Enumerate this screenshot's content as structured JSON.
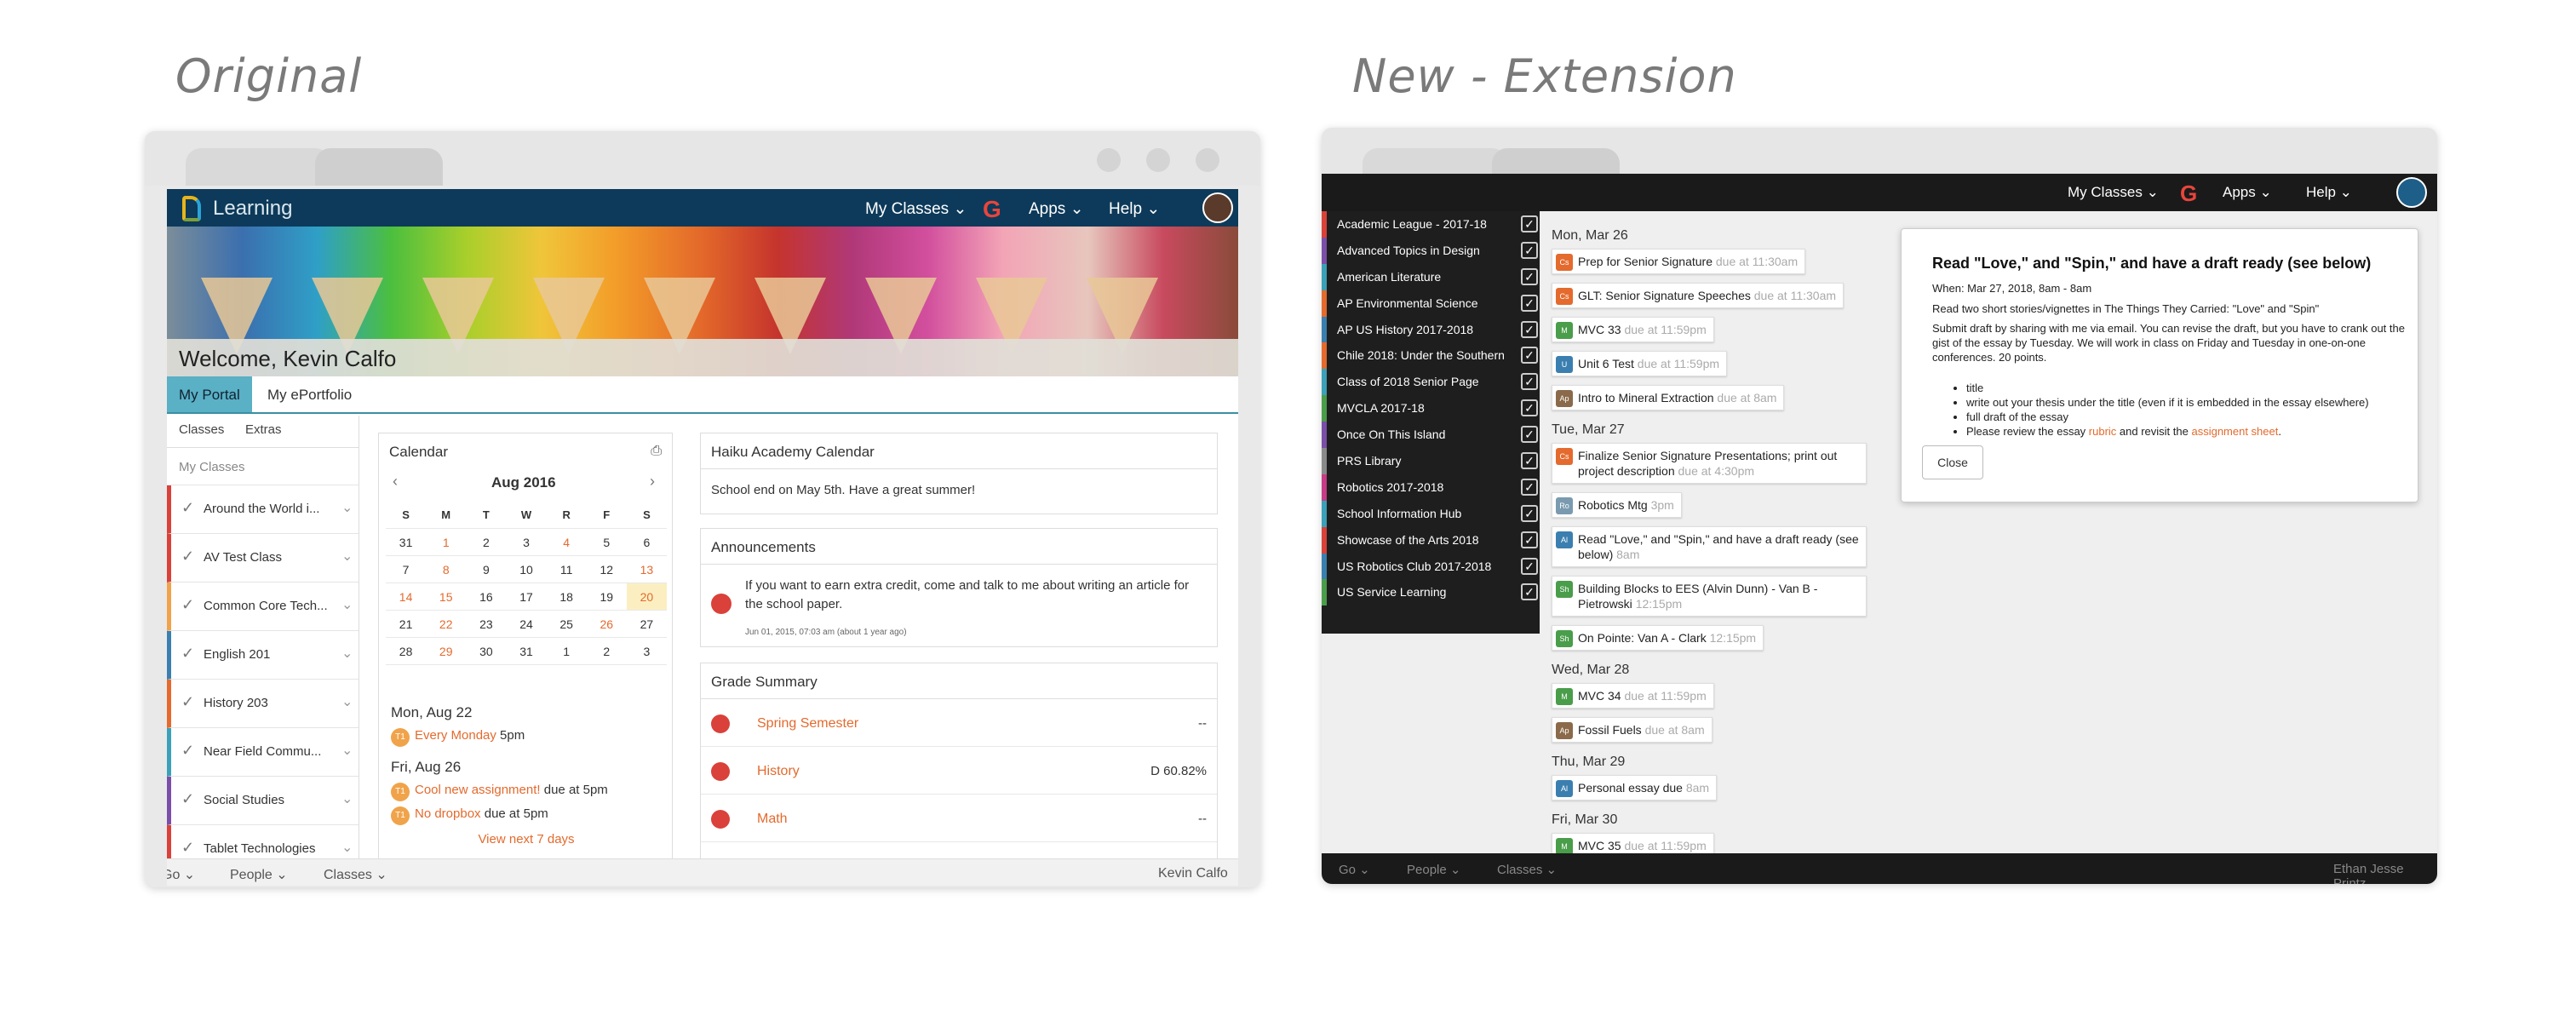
{
  "headings": {
    "left": "Original",
    "right": "New - Extension"
  },
  "original": {
    "brand": "Learning",
    "nav": {
      "my_classes": "My Classes ⌄",
      "apps": "Apps ⌄",
      "help": "Help ⌄",
      "google": "G"
    },
    "welcome": "Welcome, Kevin Calfo",
    "tabs": [
      "My Portal",
      "My ePortfolio"
    ],
    "sidebar": {
      "tabs": [
        "Classes",
        "Extras"
      ],
      "heading": "My Classes",
      "classes": [
        {
          "label": "Around the World i...",
          "color": "#d9413a"
        },
        {
          "label": "AV Test Class",
          "color": "#d9413a"
        },
        {
          "label": "Common Core Tech...",
          "color": "#f0a34a"
        },
        {
          "label": "English 201",
          "color": "#3b7fb0"
        },
        {
          "label": "History 203",
          "color": "#e46a2d"
        },
        {
          "label": "Near Field Commu...",
          "color": "#3aa1b8"
        },
        {
          "label": "Social Studies",
          "color": "#7b4fa8"
        },
        {
          "label": "Tablet Technologies",
          "color": "#d9413a"
        }
      ]
    },
    "calendar": {
      "title": "Calendar",
      "print_icon": "printer-icon",
      "month": "Aug 2016",
      "prev": "‹",
      "next": "›",
      "weekdays": [
        "S",
        "M",
        "T",
        "W",
        "R",
        "F",
        "S"
      ],
      "weeks": [
        [
          "31",
          "1",
          "2",
          "3",
          "4",
          "5",
          "6"
        ],
        [
          "7",
          "8",
          "9",
          "10",
          "11",
          "12",
          "13"
        ],
        [
          "14",
          "15",
          "16",
          "17",
          "18",
          "19",
          "20"
        ],
        [
          "21",
          "22",
          "23",
          "24",
          "25",
          "26",
          "27"
        ],
        [
          "28",
          "29",
          "30",
          "31",
          "1",
          "2",
          "3"
        ]
      ],
      "event_days": [
        {
          "date": "Mon, Aug 22",
          "events": [
            {
              "badge": "T1",
              "link": "Every Monday",
              "suffix": " 5pm"
            }
          ]
        },
        {
          "date": "Fri, Aug 26",
          "events": [
            {
              "badge": "T1",
              "link": "Cool new assignment!",
              "suffix": " due at 5pm"
            },
            {
              "badge": "T1",
              "link": "No dropbox",
              "suffix": " due at 5pm"
            }
          ]
        }
      ],
      "view_next": "View next 7 days"
    },
    "haiku": {
      "title": "Haiku Academy Calendar",
      "body": "School end on May 5th. Have a great summer!"
    },
    "announcements": {
      "title": "Announcements",
      "text": "If you want to earn extra credit, come and talk to me about writing an article for the school paper.",
      "meta": "Jun 01, 2015, 07:03 am (about 1 year ago)"
    },
    "grades": {
      "title": "Grade Summary",
      "rows": [
        {
          "name": "Spring Semester",
          "value": "--"
        },
        {
          "name": "History",
          "value": "D 60.82%"
        },
        {
          "name": "Math",
          "value": "--"
        }
      ]
    },
    "bottom": {
      "go": "Go ⌄",
      "people": "People ⌄",
      "classes": "Classes ⌄",
      "user": "Kevin Calfo"
    }
  },
  "extension": {
    "nav": {
      "my_classes": "My Classes ⌄",
      "apps": "Apps ⌄",
      "help": "Help ⌄",
      "google": "G"
    },
    "sidebar": [
      {
        "label": "Academic League - 2017-18",
        "color": "#d9413a"
      },
      {
        "label": "Advanced Topics in Design",
        "color": "#7b4fa8"
      },
      {
        "label": "American Literature",
        "color": "#3aa1b8"
      },
      {
        "label": "AP Environmental Science",
        "color": "#e46a2d"
      },
      {
        "label": "AP US History 2017-2018",
        "color": "#3b7fb0"
      },
      {
        "label": "Chile 2018: Under the Southern",
        "color": "#e46a2d"
      },
      {
        "label": "Class of 2018 Senior Page",
        "color": "#3aa1b8"
      },
      {
        "label": "MVCLA 2017-18",
        "color": "#4a9d4a"
      },
      {
        "label": "Once On This Island",
        "color": "#7b4fa8"
      },
      {
        "label": "PRS Library",
        "color": "#8a8a8a"
      },
      {
        "label": "Robotics 2017-2018",
        "color": "#c63c86"
      },
      {
        "label": "School Information Hub",
        "color": "#3aa1b8"
      },
      {
        "label": "Showcase of the Arts 2018",
        "color": "#d9413a"
      },
      {
        "label": "US Robotics Club 2017-2018",
        "color": "#3b7fb0"
      },
      {
        "label": "US Service Learning",
        "color": "#4a9d4a"
      }
    ],
    "feed": [
      {
        "day": "Mon, Mar 26",
        "items": [
          {
            "badge": "Cs",
            "color": "#e46a2d",
            "title": "Prep for Senior Signature",
            "due": "due at 11:30am"
          },
          {
            "badge": "Cs",
            "color": "#e46a2d",
            "title": "GLT: Senior Signature Speeches",
            "due": "due at 11:30am"
          },
          {
            "badge": "M",
            "color": "#4a9d4a",
            "title": "MVC 33",
            "due": "due at 11:59pm"
          },
          {
            "badge": "U",
            "color": "#3b7fb0",
            "title": "Unit 6 Test",
            "due": "due at 11:59pm"
          },
          {
            "badge": "Ap",
            "color": "#8a6a4a",
            "title": "Intro to Mineral Extraction",
            "due": "due at 8am"
          }
        ]
      },
      {
        "day": "Tue, Mar 27",
        "items": [
          {
            "badge": "Cs",
            "color": "#e46a2d",
            "title": "Finalize Senior Signature Presentations; print out project description",
            "due": "due at 4:30pm"
          },
          {
            "badge": "Ro",
            "color": "#7a9ab0",
            "title": "Robotics Mtg",
            "due": "3pm"
          },
          {
            "badge": "Al",
            "color": "#3b7fb0",
            "title": "Read \"Love,\" and \"Spin,\" and have a draft ready (see below)",
            "due": "8am"
          },
          {
            "badge": "Sh",
            "color": "#4a9d4a",
            "title": "Building Blocks to EES (Alvin Dunn) - Van B - Pietrowski",
            "due": "12:15pm"
          },
          {
            "badge": "Sh",
            "color": "#4a9d4a",
            "title": "On Pointe: Van A - Clark",
            "due": "12:15pm"
          }
        ]
      },
      {
        "day": "Wed, Mar 28",
        "items": [
          {
            "badge": "M",
            "color": "#4a9d4a",
            "title": "MVC 34",
            "due": "due at 11:59pm"
          },
          {
            "badge": "Ap",
            "color": "#8a6a4a",
            "title": "Fossil Fuels",
            "due": "due at 8am"
          }
        ]
      },
      {
        "day": "Thu, Mar 29",
        "items": [
          {
            "badge": "Al",
            "color": "#3b7fb0",
            "title": "Personal essay due",
            "due": "8am"
          }
        ]
      },
      {
        "day": "Fri, Mar 30",
        "items": [
          {
            "badge": "M",
            "color": "#4a9d4a",
            "title": "MVC 35",
            "due": "due at 11:59pm"
          }
        ]
      }
    ],
    "modal": {
      "title": "Read \"Love,\" and \"Spin,\" and have a draft ready (see below)",
      "when": "When: Mar 27, 2018, 8am - 8am",
      "p1": "Read two short stories/vignettes in The Things They Carried: \"Love\" and \"Spin\"",
      "p2": "Submit draft by sharing with me via email. You can revise the draft, but you have to crank out the gist of the essay by Tuesday. We will work in class on Friday and Tuesday in one-on-one conferences. 20 points.",
      "list": [
        "title",
        "write out your thesis under the title (even if it is embedded in the essay elsewhere)",
        "full draft of the essay"
      ],
      "last_prefix": "Please review the essay ",
      "last_link1": "rubric",
      "last_mid": " and revisit the ",
      "last_link2": "assignment sheet",
      "last_suffix": ".",
      "close": "Close"
    },
    "bottom": {
      "go": "Go ⌄",
      "people": "People ⌄",
      "classes": "Classes ⌄",
      "user": "Ethan Jesse Printz"
    }
  }
}
